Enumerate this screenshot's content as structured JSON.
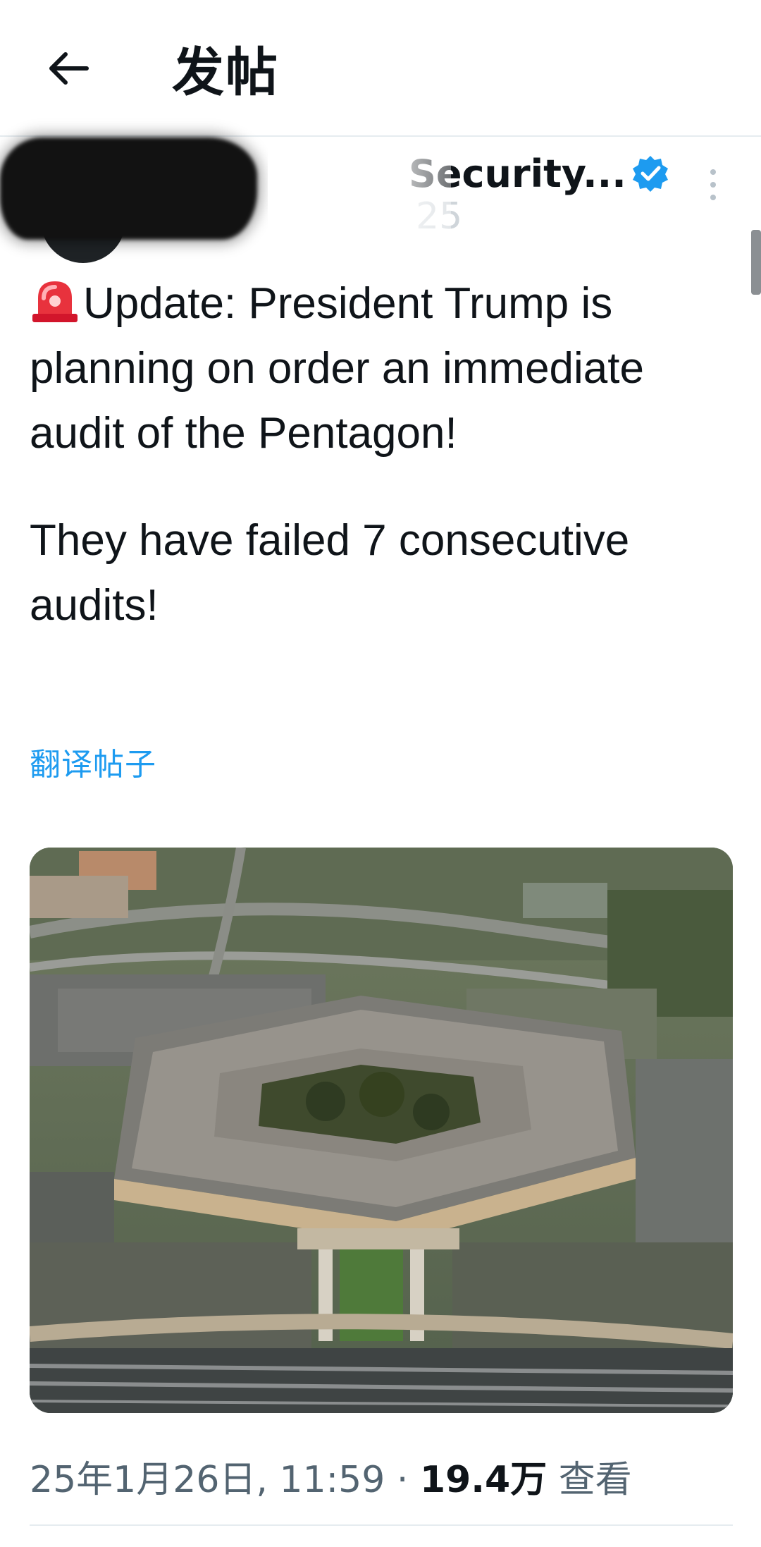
{
  "header": {
    "title": "发帖"
  },
  "author": {
    "display_name": "Security...",
    "handle": "25",
    "verified_color": "#1d9bf0"
  },
  "post": {
    "paragraph1": "Update: President Trump is planning on order an immediate audit of the Pentagon!",
    "paragraph2": "They have failed 7 consecutive audits!",
    "emoji": "siren-emoji",
    "translate_label": "翻译帖子"
  },
  "media": {
    "subject": "aerial-photo-pentagon"
  },
  "footer": {
    "date": "25年1月26日",
    "time": "11:59",
    "views_count": "19.4万",
    "views_label": "查看"
  },
  "colors": {
    "accent": "#1d9bf0",
    "text": "#0f1419",
    "muted": "#536471"
  }
}
